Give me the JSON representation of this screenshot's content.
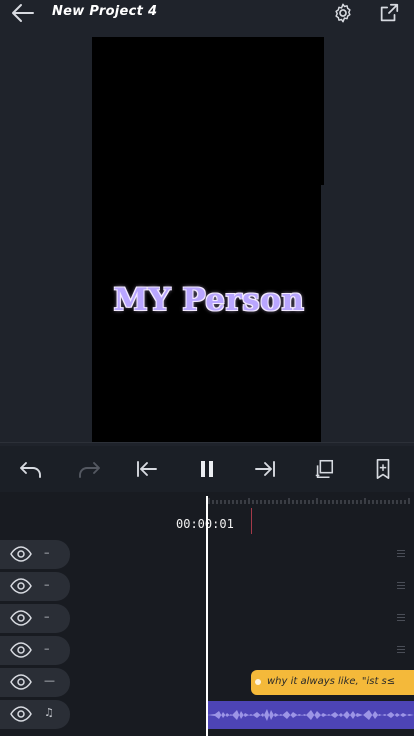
{
  "header": {
    "title": "New Project 4",
    "back_icon": "arrow-left-icon",
    "settings_icon": "gear-icon",
    "export_icon": "share-export-icon"
  },
  "preview": {
    "overlay_text": "MY Person",
    "overlay_color": "#b9a6ff"
  },
  "toolbar": {
    "buttons": [
      {
        "name": "undo-button",
        "icon": "undo-icon",
        "enabled": true
      },
      {
        "name": "redo-button",
        "icon": "redo-icon",
        "enabled": false
      },
      {
        "name": "jump-to-start-button",
        "icon": "skip-to-start-icon",
        "enabled": true
      },
      {
        "name": "pause-button",
        "icon": "pause-icon",
        "enabled": true
      },
      {
        "name": "jump-to-end-button",
        "icon": "skip-to-end-icon",
        "enabled": true
      },
      {
        "name": "fullscreen-button",
        "icon": "fullscreen-icon",
        "enabled": true
      },
      {
        "name": "bookmark-button",
        "icon": "bookmark-add-icon",
        "enabled": true
      }
    ]
  },
  "timeline": {
    "timecode": "00:00:01",
    "tracks": [
      {
        "mark": "–",
        "icon": "eye-icon"
      },
      {
        "mark": "–",
        "icon": "eye-icon"
      },
      {
        "mark": "–",
        "icon": "eye-icon"
      },
      {
        "mark": "–",
        "icon": "eye-icon"
      },
      {
        "mark": "—",
        "icon": "eye-icon"
      },
      {
        "mark": "♫",
        "icon": "eye-icon"
      }
    ],
    "text_clip_label": "why it always like, \"ist s≤",
    "text_clip_color": "#f4b93a",
    "audio_clip_color": "#4d44b6"
  },
  "colors": {
    "background": "#1f232b",
    "canvas": "#000000",
    "playhead": "#ffffff",
    "marker": "#a43a49"
  }
}
